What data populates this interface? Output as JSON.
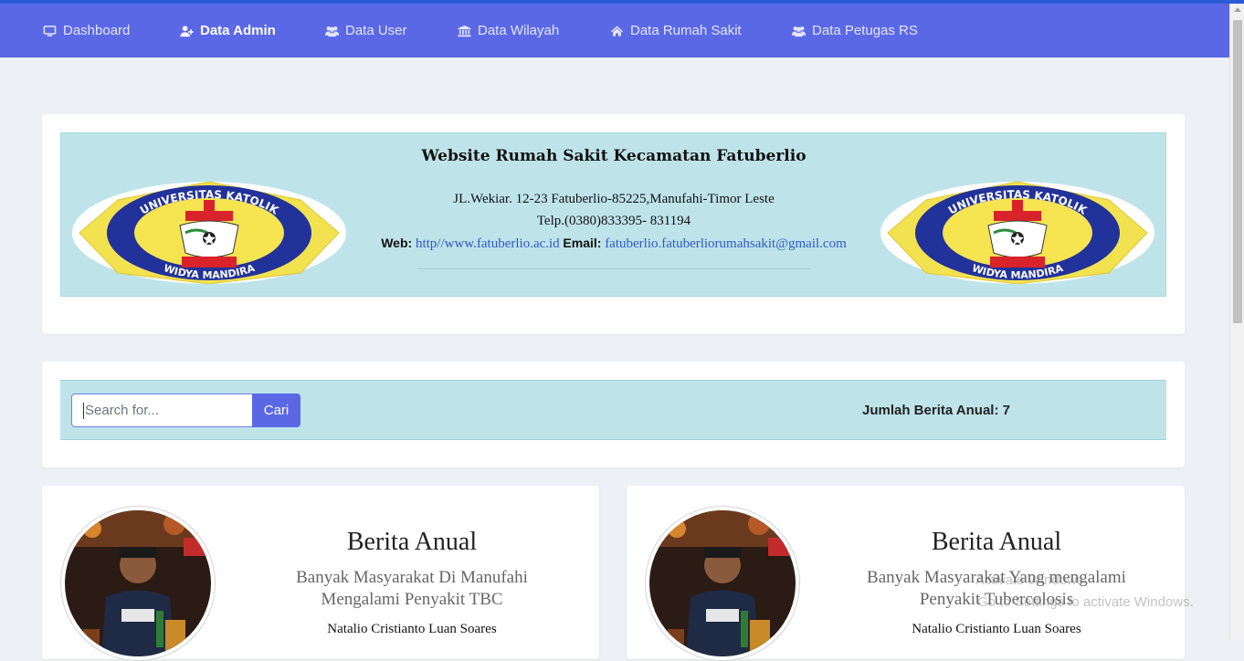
{
  "nav": {
    "items": [
      {
        "label": "Dashboard",
        "icon": "monitor-icon"
      },
      {
        "label": "Data Admin",
        "icon": "user-plus-icon"
      },
      {
        "label": "Data User",
        "icon": "users-icon"
      },
      {
        "label": "Data Wilayah",
        "icon": "bank-icon"
      },
      {
        "label": "Data Rumah Sakit",
        "icon": "home-icon"
      },
      {
        "label": "Data Petugas RS",
        "icon": "users-icon"
      }
    ],
    "active": "Data Admin"
  },
  "header": {
    "title": "Website Rumah Sakit Kecamatan Fatuberlio",
    "address": "JL.Wekiar. 12-23 Fatuberlio-85225,Manufahi-Timor Leste",
    "telp": "Telp.(0380)833395- 831194",
    "web_label": "Web:",
    "web_value": "http//www.fatuberlio.ac.id",
    "email_label": "Email:",
    "email_value": "fatuberlio.fatuberliorumahsakit@gmail.com",
    "logo_top_text": "UNIVERSITAS KATOLIK",
    "logo_bottom_text": "WIDYA MANDIRA"
  },
  "search": {
    "placeholder": "Search for...",
    "button_label": "Cari",
    "count_text": "Jumlah Berita Anual: 7"
  },
  "news": [
    {
      "title": "Berita Anual",
      "subtitle_line1": "Banyak Masyarakat Di Manufahi",
      "subtitle_line2": "Mengalami Penyakit TBC",
      "author": "Natalio Cristianto Luan Soares"
    },
    {
      "title": "Berita Anual",
      "subtitle_line1": "Banyak Masyarakat Yang mengalami",
      "subtitle_line2": "Penyakit Tubercolosis",
      "author": "Natalio Cristianto Luan Soares"
    }
  ],
  "watermark": {
    "line1": "Activate Windows",
    "line2": "Go to Settings to activate Windows."
  },
  "colors": {
    "navbar": "#5b68e6",
    "header_bg": "#bee4ea",
    "page_bg": "#edf0f4"
  }
}
